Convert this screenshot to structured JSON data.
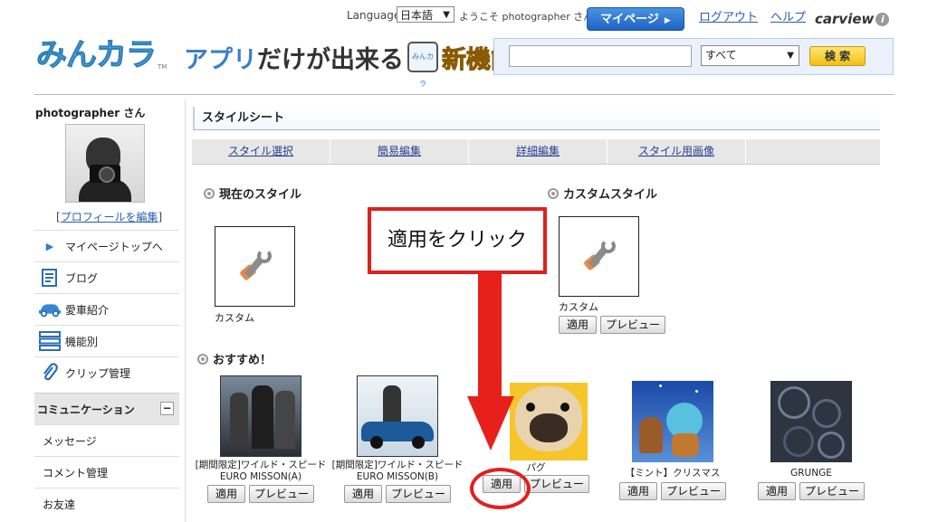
{
  "header": {
    "language_label": "Language",
    "language_value": "日本語",
    "welcome": "ようこそ photographer さん",
    "mypage": "マイページ",
    "logout": "ログアウト",
    "help": "ヘルプ",
    "carview": "carview",
    "logo": "みんカラ",
    "logo_tm": "TM",
    "promo_a": "アプリ",
    "promo_b": "だけが出来る",
    "promo_badge": "みんカラ",
    "promo_c": "新機能"
  },
  "search": {
    "placeholder": "",
    "scope": "すべて",
    "button": "検 索"
  },
  "sidebar": {
    "username": "photographer さん",
    "profile_edit": "プロフィールを編集",
    "items": [
      {
        "label": "マイページトップへ"
      },
      {
        "label": "ブログ"
      },
      {
        "label": "愛車紹介"
      },
      {
        "label": "機能別"
      },
      {
        "label": "クリップ管理"
      }
    ],
    "section": "コミュニケーション",
    "sub_items": [
      {
        "label": "メッセージ"
      },
      {
        "label": "コメント管理"
      },
      {
        "label": "お友達"
      }
    ]
  },
  "main": {
    "title": "スタイルシート",
    "tabs": [
      {
        "label": "スタイル選択"
      },
      {
        "label": "簡易編集"
      },
      {
        "label": "詳細編集"
      },
      {
        "label": "スタイル用画像"
      }
    ],
    "current_style": {
      "heading": "現在のスタイル",
      "name": "カスタム"
    },
    "custom_style": {
      "heading": "カスタムスタイル",
      "name": "カスタム",
      "apply": "適用",
      "preview": "プレビュー"
    },
    "recommended": {
      "heading": "おすすめ！",
      "items": [
        {
          "caption": "[期間限定]ワイルド・スピードEURO MISSON(A)",
          "apply": "適用",
          "preview": "プレビュー"
        },
        {
          "caption": "[期間限定]ワイルド・スピードEURO MISSON(B)",
          "apply": "適用",
          "preview": "プレビュー"
        },
        {
          "caption": "パグ",
          "apply": "適用",
          "preview": "プレビュー"
        },
        {
          "caption": "【ミント】クリスマス",
          "apply": "適用",
          "preview": "プレビュー"
        },
        {
          "caption": "GRUNGE",
          "apply": "適用",
          "preview": "プレビュー"
        }
      ]
    }
  },
  "annotation": {
    "callout": "適用をクリック",
    "color": "#e02020"
  }
}
